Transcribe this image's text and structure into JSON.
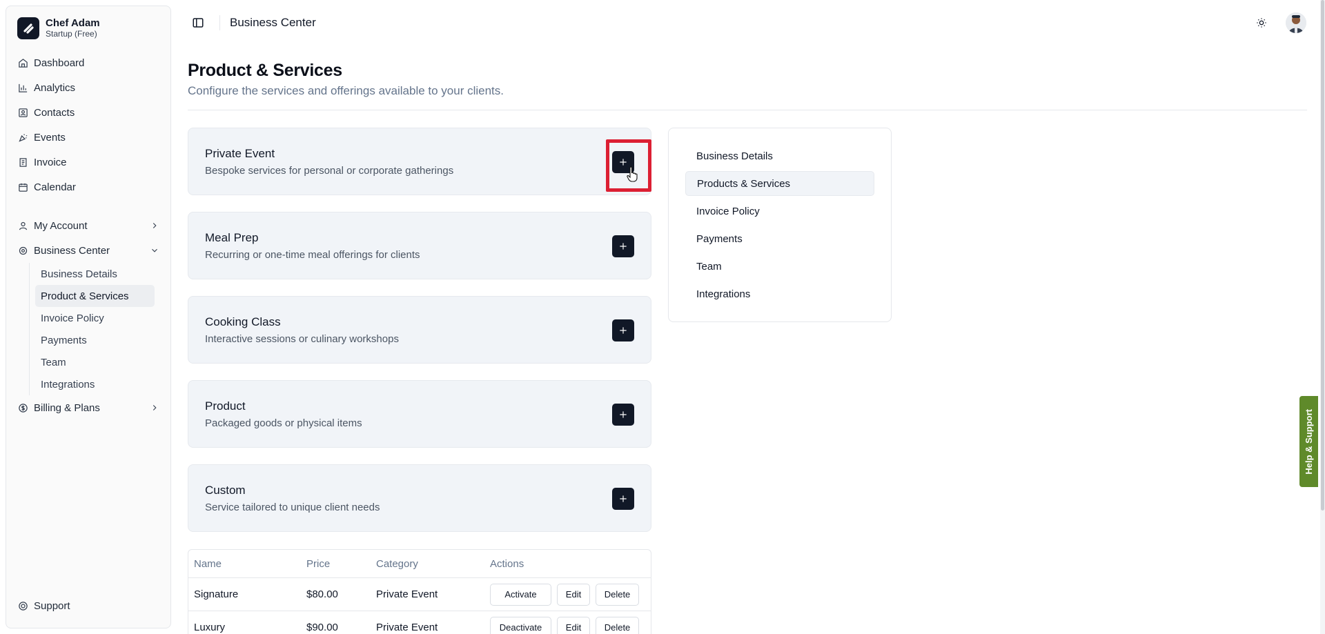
{
  "brand": {
    "name": "Chef Adam",
    "plan": "Startup (Free)"
  },
  "nav": {
    "main": [
      {
        "label": "Dashboard",
        "icon": "home-icon"
      },
      {
        "label": "Analytics",
        "icon": "bar-chart-icon"
      },
      {
        "label": "Contacts",
        "icon": "contact-card-icon"
      },
      {
        "label": "Events",
        "icon": "party-popper-icon"
      },
      {
        "label": "Invoice",
        "icon": "receipt-icon"
      },
      {
        "label": "Calendar",
        "icon": "calendar-icon"
      }
    ],
    "my_account": "My Account",
    "business_center": "Business Center",
    "business_sub": [
      {
        "label": "Business Details"
      },
      {
        "label": "Product & Services"
      },
      {
        "label": "Invoice Policy"
      },
      {
        "label": "Payments"
      },
      {
        "label": "Team"
      },
      {
        "label": "Integrations"
      }
    ],
    "billing": "Billing & Plans",
    "support": "Support"
  },
  "topbar": {
    "breadcrumb": "Business Center"
  },
  "header": {
    "title": "Product & Services",
    "subtitle": "Configure the services and offerings available to your clients."
  },
  "cards": [
    {
      "title": "Private Event",
      "desc": "Bespoke services for personal or corporate gatherings"
    },
    {
      "title": "Meal Prep",
      "desc": "Recurring or one-time meal offerings for clients"
    },
    {
      "title": "Cooking Class",
      "desc": "Interactive sessions or culinary workshops"
    },
    {
      "title": "Product",
      "desc": "Packaged goods or physical items"
    },
    {
      "title": "Custom",
      "desc": "Service tailored to unique client needs"
    }
  ],
  "table": {
    "headers": {
      "name": "Name",
      "price": "Price",
      "category": "Category",
      "actions": "Actions"
    },
    "rows": [
      {
        "name": "Signature",
        "price": "$80.00",
        "category": "Private Event",
        "toggle": "Activate",
        "edit": "Edit",
        "delete": "Delete"
      },
      {
        "name": "Luxury",
        "price": "$90.00",
        "category": "Private Event",
        "toggle": "Deactivate",
        "edit": "Edit",
        "delete": "Delete"
      }
    ]
  },
  "settings_nav": [
    {
      "label": "Business Details"
    },
    {
      "label": "Products & Services"
    },
    {
      "label": "Invoice Policy"
    },
    {
      "label": "Payments"
    },
    {
      "label": "Team"
    },
    {
      "label": "Integrations"
    }
  ],
  "help_tab": "Help & Support",
  "colors": {
    "accent": "#111827",
    "highlight": "#dc1f33",
    "help": "#5f8a2a"
  }
}
